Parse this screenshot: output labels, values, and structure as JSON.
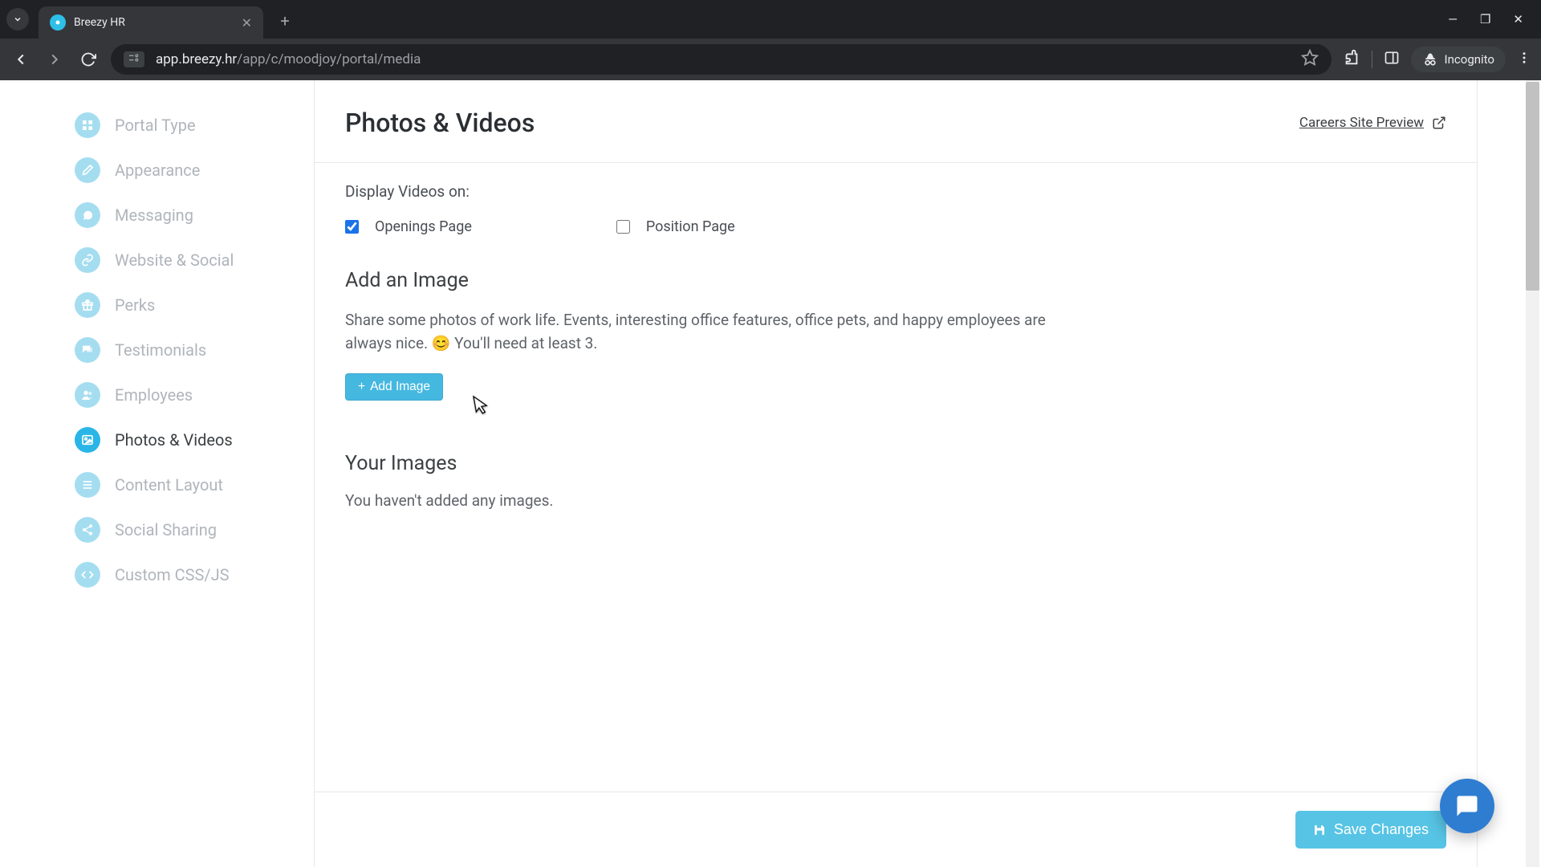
{
  "browser": {
    "tab_title": "Breezy HR",
    "url_host": "app.breezy.hr",
    "url_path": "/app/c/moodjoy/portal/media",
    "incognito_label": "Incognito"
  },
  "sidebar": {
    "items": [
      {
        "label": "Portal Type",
        "icon": "grid"
      },
      {
        "label": "Appearance",
        "icon": "brush"
      },
      {
        "label": "Messaging",
        "icon": "chat"
      },
      {
        "label": "Website & Social",
        "icon": "link"
      },
      {
        "label": "Perks",
        "icon": "gift"
      },
      {
        "label": "Testimonials",
        "icon": "comments"
      },
      {
        "label": "Employees",
        "icon": "people"
      },
      {
        "label": "Photos & Videos",
        "icon": "image"
      },
      {
        "label": "Content Layout",
        "icon": "layout"
      },
      {
        "label": "Social Sharing",
        "icon": "share"
      },
      {
        "label": "Custom CSS/JS",
        "icon": "code"
      }
    ],
    "active_index": 7
  },
  "header": {
    "title": "Photos & Videos",
    "preview_label": "Careers Site Preview"
  },
  "videos_section": {
    "label": "Display Videos on:",
    "openings_label": "Openings Page",
    "openings_checked": true,
    "position_label": "Position Page",
    "position_checked": false
  },
  "add_image": {
    "heading": "Add an Image",
    "description": "Share some photos of work life. Events, interesting office features, office pets, and happy employees are always nice. 😊 You'll need at least 3.",
    "button_label": "Add Image"
  },
  "your_images": {
    "heading": "Your Images",
    "empty_text": "You haven't added any images."
  },
  "footer": {
    "save_label": "Save Changes"
  }
}
